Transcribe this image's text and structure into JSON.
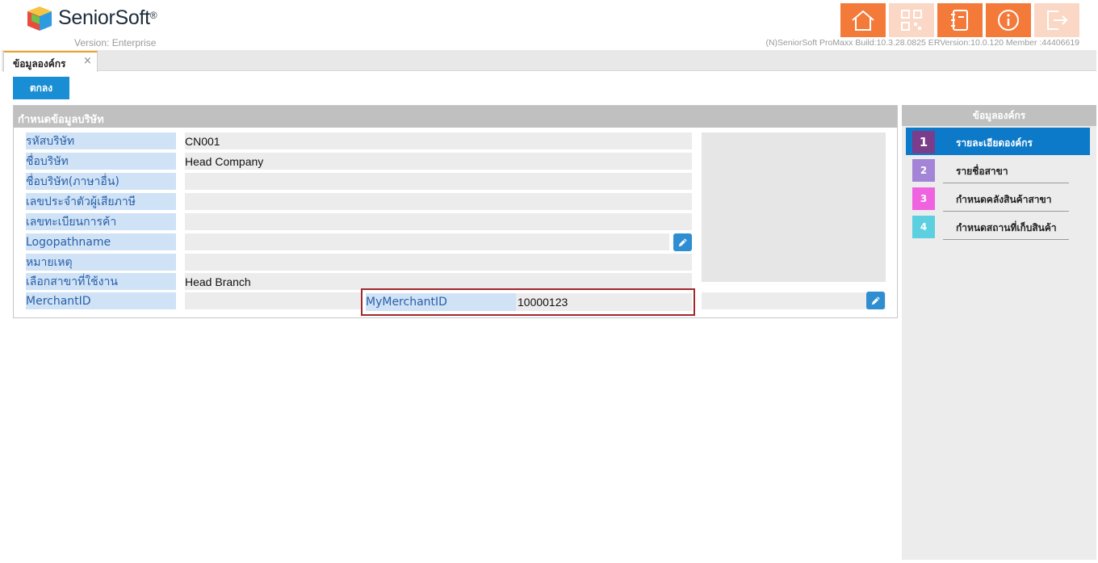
{
  "header": {
    "brand": "SeniorSoft",
    "registered": "®",
    "version": "Version: Enterprise",
    "build": "(N)SeniorSoft ProMaxx Build:10.3.28.0825 ERVersion:10.0.120 Member :44406619",
    "buttons": [
      {
        "icon": "home-icon",
        "enabled": true
      },
      {
        "icon": "qr-code-icon",
        "enabled": false
      },
      {
        "icon": "notebook-icon",
        "enabled": true
      },
      {
        "icon": "info-icon",
        "enabled": true
      },
      {
        "icon": "logout-icon",
        "enabled": false
      }
    ]
  },
  "tabs": [
    {
      "label": "ข้อมูลองค์กร",
      "close": "×"
    }
  ],
  "toolbar": {
    "ok_label": "ตกลง"
  },
  "panel": {
    "title": "กำหนดข้อมูลบริษัท",
    "rows": [
      {
        "label": "รหัสบริษัท",
        "value": "CN001"
      },
      {
        "label": "ชื่อบริษัท",
        "value": "Head Company"
      },
      {
        "label": "ชื่อบริษัท(ภาษาอื่น)",
        "value": ""
      },
      {
        "label": "เลขประจำตัวผู้เสียภาษี",
        "value": ""
      },
      {
        "label": "เลขทะเบียนการค้า",
        "value": ""
      },
      {
        "label": "Logopathname",
        "value": ""
      },
      {
        "label": "หมายเหตุ",
        "value": ""
      },
      {
        "label": "เลือกสาขาที่ใช้งาน",
        "value": "Head Branch"
      }
    ],
    "merchant": {
      "label": "MerchantID",
      "my_label": "MyMerchantID",
      "my_value": "10000123"
    }
  },
  "sidebar": {
    "title": "ข้อมูลองค์กร",
    "steps": [
      {
        "num": "1",
        "label": "รายละเอียดองค์กร",
        "color": "#7b3c8c",
        "active": true
      },
      {
        "num": "2",
        "label": "รายชื่อสาขา",
        "color": "#a384d6",
        "active": false
      },
      {
        "num": "3",
        "label": "กำหนดคลังสินค้าสาขา",
        "color": "#ef63e0",
        "active": false
      },
      {
        "num": "4",
        "label": "กำหนดสถานที่เก็บสินค้า",
        "color": "#5ccfe0",
        "active": false
      }
    ]
  },
  "colors": {
    "accent_orange": "#f47a3a",
    "primary_blue": "#1a8ed4",
    "highlight_red": "#a2282c"
  }
}
